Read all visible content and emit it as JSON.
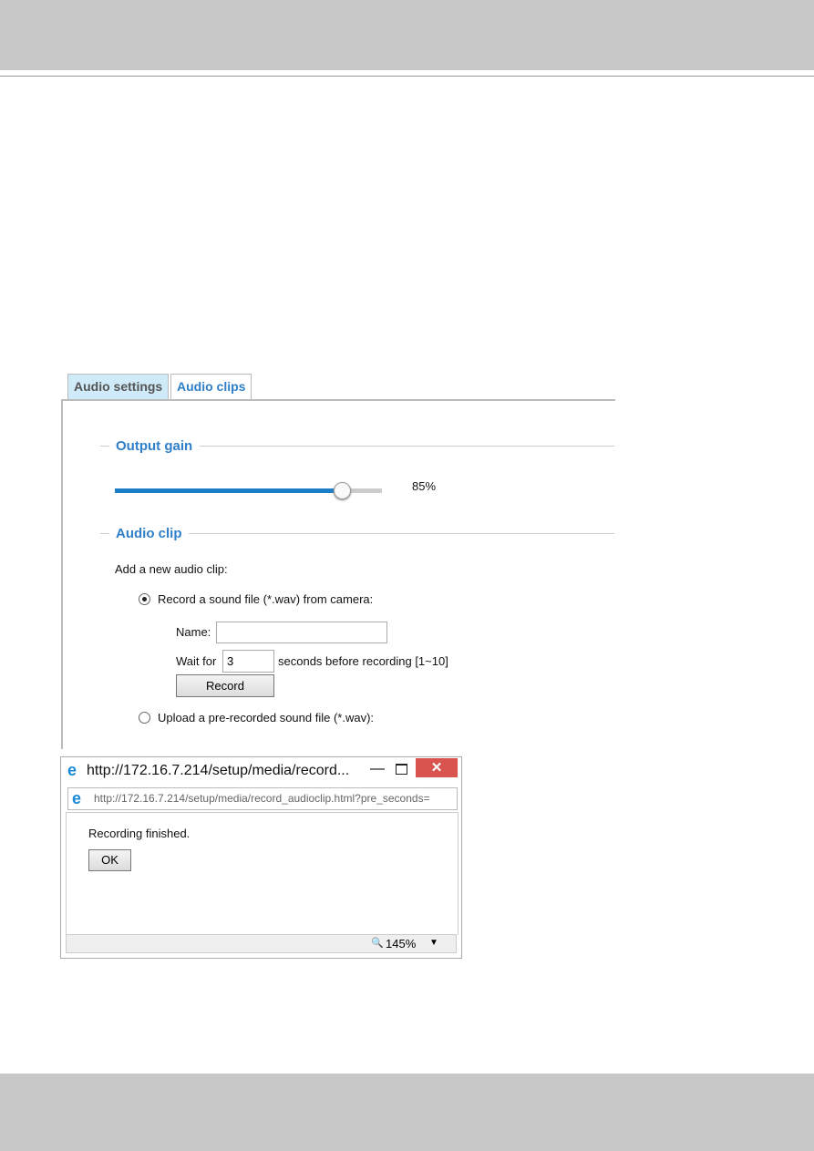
{
  "tabs": [
    {
      "label": "Audio settings",
      "active": true
    },
    {
      "label": "Audio clips",
      "active": false
    }
  ],
  "output_gain": {
    "title": "Output gain",
    "value_percent": 85,
    "value_label": "85%"
  },
  "audio_clip": {
    "title": "Audio clip",
    "add_label": "Add a new audio clip:",
    "record_option": "Record a sound file (*.wav) from camera:",
    "name_label": "Name:",
    "name_value": "",
    "wait_label": "Wait for",
    "wait_value": "3",
    "wait_suffix": "seconds before recording [1~10]",
    "record_button": "Record",
    "upload_option": "Upload a pre-recorded sound file (*.wav):",
    "selected": "record"
  },
  "popup": {
    "title": "http://172.16.7.214/setup/media/record...",
    "address": "http://172.16.7.214/setup/media/record_audioclip.html?pre_seconds=",
    "message": "Recording finished.",
    "ok_button": "OK",
    "zoom": "145%"
  },
  "colors": {
    "accent": "#2f7fc9",
    "slider_fill": "#1a7fc6",
    "close_button": "#d9534f"
  }
}
